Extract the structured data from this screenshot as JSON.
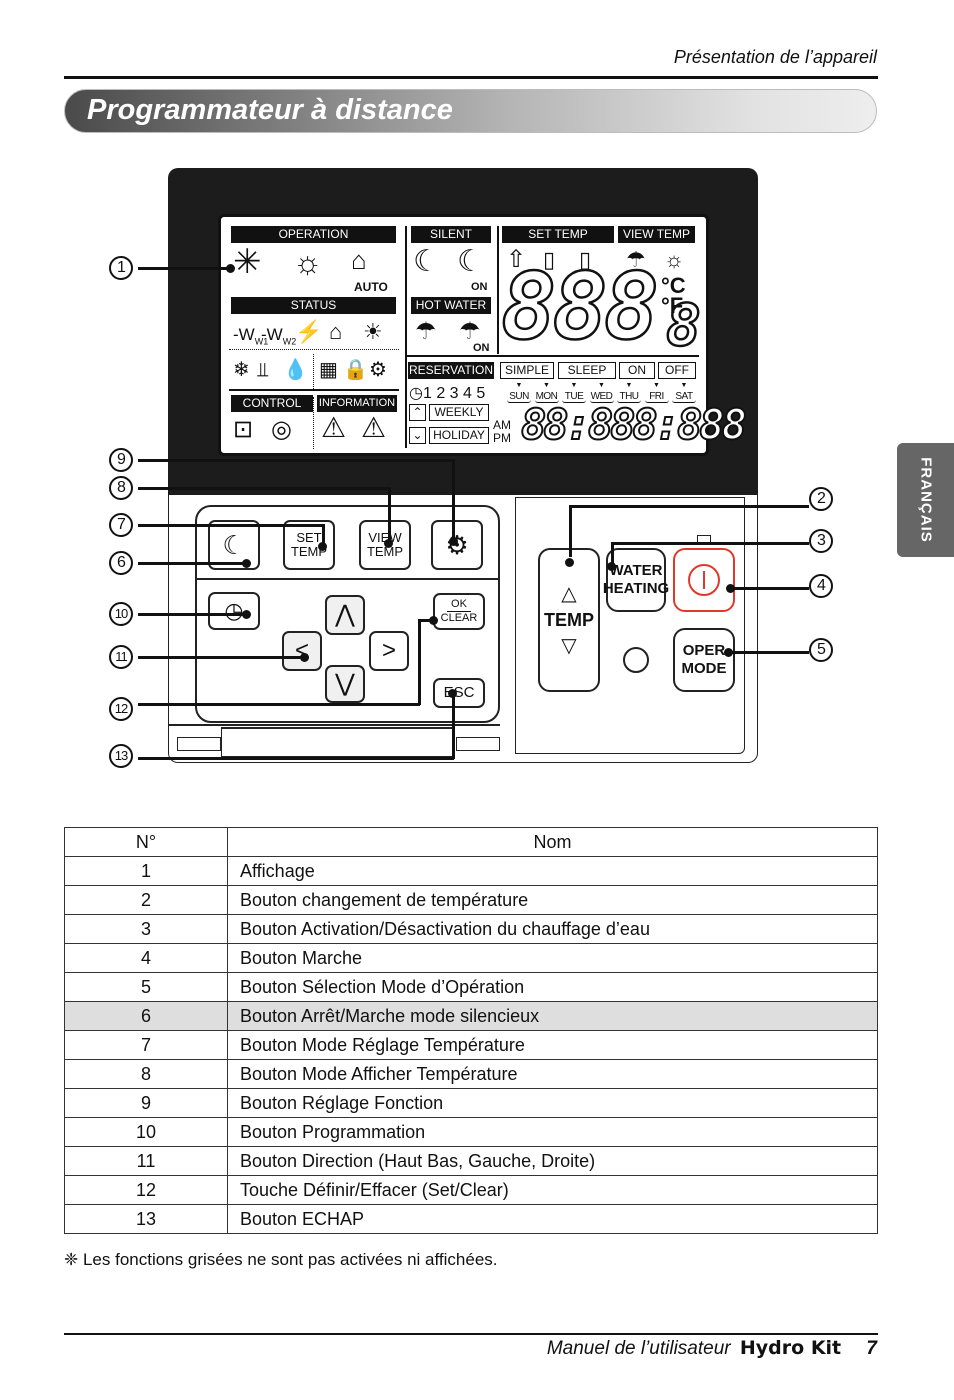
{
  "header": {
    "section": "Présentation de l’appareil",
    "title": "Programmateur à distance"
  },
  "side_tab": "FRANÇAIS",
  "display": {
    "operation_label": "OPERATION",
    "operation_icons": [
      "snowflake-cool",
      "sun-heat",
      "house-thermometer-auto"
    ],
    "auto_label": "AUTO",
    "status_label": "STATUS",
    "status_w1": "W1",
    "status_w2": "W2",
    "control_label": "CONTROL",
    "information_label": "INFORMATION",
    "silent_label": "SILENT",
    "on_label": "ON",
    "hot_water_label": "HOT WATER",
    "set_temp_label": "SET TEMP",
    "view_temp_label": "VIEW TEMP",
    "main_digits": "888",
    "decimal_digit": "8",
    "celsius": "°C",
    "fahrenheit": "°F",
    "reservation_label": "RESERVATION",
    "simple_label": "SIMPLE",
    "sleep_label": "SLEEP",
    "on_box_label": "ON",
    "off_box_label": "OFF",
    "program_numbers": "1 2 3 4 5",
    "days": [
      "SUN",
      "MON",
      "TUE",
      "WED",
      "THU",
      "FRI",
      "SAT"
    ],
    "weekly_label": "WEEKLY",
    "holiday_label": "HOLIDAY",
    "am": "AM",
    "pm": "PM",
    "time_digits": "88:888:888"
  },
  "buttons": {
    "silent": "",
    "set_temp_line1": "SET",
    "set_temp_line2": "TEMP",
    "view_temp_line1": "VIEW",
    "view_temp_line2": "TEMP",
    "ok": "OK",
    "clear": "CLEAR",
    "esc": "ESC",
    "temp": "TEMP",
    "water_heating_line1": "WATER",
    "water_heating_line2": "HEATING",
    "oper_mode_line1": "OPER",
    "oper_mode_line2": "MODE"
  },
  "callouts": [
    "①",
    "②",
    "③",
    "④",
    "⑤",
    "⑥",
    "⑦",
    "⑧",
    "⑨",
    "⑩",
    "⑪",
    "⑫",
    "⑬"
  ],
  "table": {
    "headers": [
      "N°",
      "Nom"
    ],
    "rows": [
      {
        "num": "1",
        "name": "Affichage"
      },
      {
        "num": "2",
        "name": "Bouton changement de température"
      },
      {
        "num": "3",
        "name": "Bouton Activation/Désactivation du chauffage d’eau"
      },
      {
        "num": "4",
        "name": "Bouton Marche"
      },
      {
        "num": "5",
        "name": "Bouton Sélection Mode d’Opération"
      },
      {
        "num": "6",
        "name": "Bouton Arrêt/Marche mode silencieux"
      },
      {
        "num": "7",
        "name": "Bouton Mode Réglage Température"
      },
      {
        "num": "8",
        "name": "Bouton Mode Afficher Température"
      },
      {
        "num": "9",
        "name": "Bouton Réglage Fonction"
      },
      {
        "num": "10",
        "name": "Bouton Programmation"
      },
      {
        "num": "11",
        "name": "Bouton Direction (Haut Bas, Gauche, Droite)"
      },
      {
        "num": "12",
        "name": "Touche Définir/Effacer (Set/Clear)"
      },
      {
        "num": "13",
        "name": "Bouton ECHAP"
      }
    ],
    "highlighted_row": 6
  },
  "note": "❈ Les fonctions grisées ne sont pas activées ni affichées.",
  "footer": {
    "manual": "Manuel de l’utilisateur",
    "product": "Hydro Kit",
    "page": "7"
  },
  "colors": {
    "power_button": "#e0392b",
    "highlight_row": "#dedede",
    "device_body": "#1c1c1c"
  }
}
